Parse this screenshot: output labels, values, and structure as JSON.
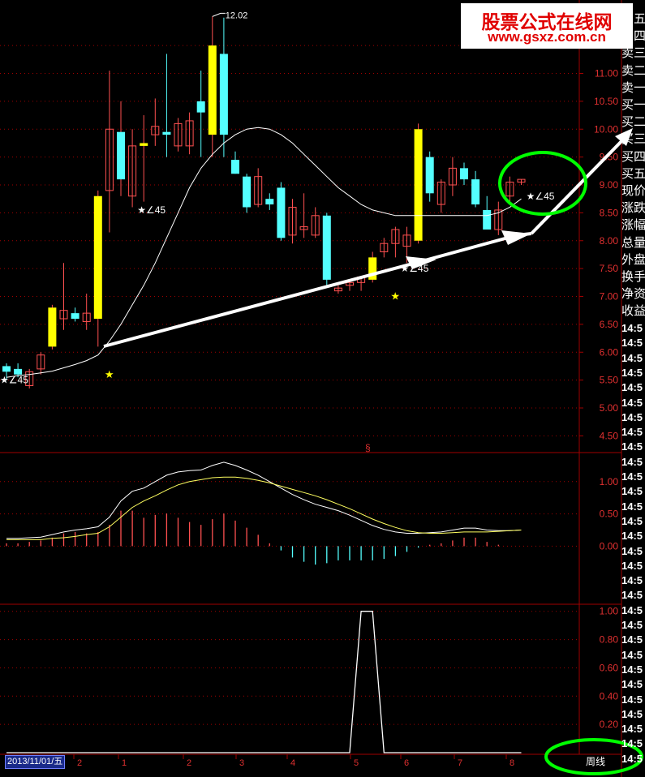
{
  "banner": {
    "title": "股票公式在线网",
    "url": "www.gsxz.com.cn"
  },
  "colors": {
    "up_hollow": "#ff5050",
    "up_yellow": "#ffff00",
    "down": "#54ffff",
    "grid": "#a00000",
    "ma": "#ffffff",
    "arrow": "#ffffff",
    "circle": "#00ff00",
    "axis_text": "#e03030"
  },
  "right_panel": {
    "labels": [
      "卖五",
      "卖四",
      "卖三",
      "卖二",
      "卖一",
      "买一",
      "买二",
      "买三",
      "买四",
      "买五",
      "现价",
      "涨跌",
      "涨幅",
      "总量",
      "外盘",
      "换手",
      "净资",
      "收益"
    ],
    "times": [
      "14:5",
      "14:5",
      "14:5",
      "14:5",
      "14:5",
      "14:5",
      "14:5",
      "14:5",
      "14:5",
      "14:5",
      "14:5",
      "14:5",
      "14:5",
      "14:5",
      "14:5",
      "14:5",
      "14:5",
      "14:5",
      "14:5",
      "14:5",
      "14:5",
      "14:5",
      "14:5",
      "14:5",
      "14:5",
      "14:5",
      "14:5",
      "14:5",
      "14:5",
      "14:5"
    ]
  },
  "period_label": "周线",
  "start_date": "2013/11/01/五",
  "chart_data": [
    {
      "type": "candlestick",
      "ylim": [
        4.2,
        12.2
      ],
      "y_ticks": [
        "4.50",
        "5.00",
        "5.50",
        "6.00",
        "6.50",
        "7.00",
        "7.50",
        "8.00",
        "8.50",
        "9.00",
        "9.50",
        "10.00",
        "10.50",
        "11.00",
        "11.50"
      ],
      "x_tick_labels": [
        "2",
        "1",
        "2",
        "3",
        "4",
        "5",
        "6",
        "7",
        "8"
      ],
      "candles": [
        {
          "o": 5.75,
          "h": 5.8,
          "l": 5.5,
          "c": 5.65
        },
        {
          "o": 5.7,
          "h": 5.8,
          "l": 5.55,
          "c": 5.6
        },
        {
          "o": 5.4,
          "h": 5.7,
          "l": 5.35,
          "c": 5.65
        },
        {
          "o": 5.7,
          "h": 6.0,
          "l": 5.6,
          "c": 5.95
        },
        {
          "o": 6.1,
          "h": 6.85,
          "l": 6.05,
          "c": 6.8
        },
        {
          "o": 6.6,
          "h": 7.6,
          "l": 6.4,
          "c": 6.75
        },
        {
          "o": 6.7,
          "h": 6.8,
          "l": 6.55,
          "c": 6.6
        },
        {
          "o": 6.55,
          "h": 7.05,
          "l": 6.4,
          "c": 6.7
        },
        {
          "o": 6.6,
          "h": 8.9,
          "l": 6.1,
          "c": 8.8
        },
        {
          "o": 8.9,
          "h": 11.05,
          "l": 8.15,
          "c": 10.0
        },
        {
          "o": 9.95,
          "h": 10.5,
          "l": 8.8,
          "c": 9.1
        },
        {
          "o": 8.8,
          "h": 10.0,
          "l": 8.6,
          "c": 9.7
        },
        {
          "o": 9.7,
          "h": 10.25,
          "l": 8.7,
          "c": 9.75
        },
        {
          "o": 9.9,
          "h": 10.55,
          "l": 9.7,
          "c": 10.05
        },
        {
          "o": 9.95,
          "h": 11.35,
          "l": 9.5,
          "c": 9.9
        },
        {
          "o": 9.7,
          "h": 10.2,
          "l": 9.6,
          "c": 10.1
        },
        {
          "o": 9.7,
          "h": 10.3,
          "l": 9.55,
          "c": 10.15
        },
        {
          "o": 10.5,
          "h": 11.05,
          "l": 9.5,
          "c": 10.3
        },
        {
          "o": 9.9,
          "h": 12.02,
          "l": 9.5,
          "c": 11.5
        },
        {
          "o": 11.35,
          "h": 12.0,
          "l": 9.5,
          "c": 9.9
        },
        {
          "o": 9.45,
          "h": 9.6,
          "l": 9.2,
          "c": 9.2
        },
        {
          "o": 9.15,
          "h": 9.2,
          "l": 8.5,
          "c": 8.6
        },
        {
          "o": 8.65,
          "h": 9.3,
          "l": 8.6,
          "c": 9.15
        },
        {
          "o": 8.75,
          "h": 8.85,
          "l": 8.55,
          "c": 8.65
        },
        {
          "o": 8.95,
          "h": 9.05,
          "l": 8.0,
          "c": 8.05
        },
        {
          "o": 8.1,
          "h": 8.75,
          "l": 7.95,
          "c": 8.6
        },
        {
          "o": 8.2,
          "h": 8.85,
          "l": 8.05,
          "c": 8.25
        },
        {
          "o": 8.1,
          "h": 8.6,
          "l": 8.05,
          "c": 8.45
        },
        {
          "o": 8.45,
          "h": 8.5,
          "l": 7.2,
          "c": 7.3
        },
        {
          "o": 7.1,
          "h": 7.2,
          "l": 7.05,
          "c": 7.15
        },
        {
          "o": 7.2,
          "h": 7.3,
          "l": 7.1,
          "c": 7.25
        },
        {
          "o": 7.25,
          "h": 7.35,
          "l": 7.1,
          "c": 7.35
        },
        {
          "o": 7.3,
          "h": 7.8,
          "l": 7.25,
          "c": 7.7
        },
        {
          "o": 7.8,
          "h": 8.05,
          "l": 7.7,
          "c": 7.95
        },
        {
          "o": 7.95,
          "h": 8.25,
          "l": 7.7,
          "c": 8.2
        },
        {
          "o": 7.9,
          "h": 8.25,
          "l": 7.6,
          "c": 8.1
        },
        {
          "o": 8.0,
          "h": 10.1,
          "l": 7.95,
          "c": 10.0
        },
        {
          "o": 9.5,
          "h": 9.6,
          "l": 8.7,
          "c": 8.85
        },
        {
          "o": 8.65,
          "h": 9.1,
          "l": 8.5,
          "c": 9.05
        },
        {
          "o": 9.0,
          "h": 9.5,
          "l": 8.8,
          "c": 9.3
        },
        {
          "o": 9.3,
          "h": 9.4,
          "l": 9.0,
          "c": 9.1
        },
        {
          "o": 9.1,
          "h": 9.25,
          "l": 8.6,
          "c": 8.65
        },
        {
          "o": 8.55,
          "h": 8.8,
          "l": 8.2,
          "c": 8.2
        },
        {
          "o": 8.2,
          "h": 8.7,
          "l": 8.1,
          "c": 8.55
        },
        {
          "o": 8.8,
          "h": 9.15,
          "l": 8.65,
          "c": 9.05
        },
        {
          "o": 9.05,
          "h": 9.1,
          "l": 9.0,
          "c": 9.1
        }
      ],
      "yellow_up_indices": [
        4,
        8,
        10,
        12,
        18,
        32,
        36
      ],
      "ma": [
        5.55,
        5.58,
        5.6,
        5.63,
        5.66,
        5.72,
        5.78,
        5.85,
        5.95,
        6.2,
        6.5,
        6.85,
        7.2,
        7.6,
        8.05,
        8.5,
        8.95,
        9.3,
        9.55,
        9.75,
        9.9,
        10.0,
        10.03,
        10.0,
        9.9,
        9.75,
        9.55,
        9.35,
        9.15,
        8.95,
        8.8,
        8.65,
        8.55,
        8.5,
        8.45,
        8.45,
        8.45,
        8.45,
        8.45,
        8.45,
        8.45,
        8.45,
        8.45,
        8.5,
        8.6,
        8.75
      ],
      "annotations": {
        "max_label": "12.02",
        "angle_label": "∠45",
        "section_mark": "§"
      }
    },
    {
      "type": "line",
      "name": "MACD",
      "ylim": [
        -0.9,
        1.45
      ],
      "y_ticks": [
        "0.00",
        "0.50",
        "1.00"
      ],
      "dif": [
        0.12,
        0.12,
        0.13,
        0.14,
        0.18,
        0.22,
        0.25,
        0.27,
        0.3,
        0.45,
        0.7,
        0.85,
        0.9,
        1.0,
        1.1,
        1.15,
        1.17,
        1.18,
        1.25,
        1.3,
        1.25,
        1.18,
        1.1,
        1.0,
        0.9,
        0.8,
        0.72,
        0.65,
        0.6,
        0.55,
        0.48,
        0.4,
        0.32,
        0.26,
        0.22,
        0.2,
        0.2,
        0.21,
        0.22,
        0.25,
        0.28,
        0.28,
        0.25,
        0.24,
        0.24,
        0.25
      ],
      "dea": [
        0.1,
        0.1,
        0.1,
        0.1,
        0.12,
        0.13,
        0.15,
        0.18,
        0.2,
        0.3,
        0.45,
        0.6,
        0.7,
        0.78,
        0.87,
        0.95,
        1.0,
        1.03,
        1.06,
        1.07,
        1.07,
        1.05,
        1.02,
        0.98,
        0.93,
        0.88,
        0.83,
        0.78,
        0.72,
        0.65,
        0.58,
        0.5,
        0.42,
        0.35,
        0.29,
        0.24,
        0.21,
        0.2,
        0.2,
        0.21,
        0.22,
        0.22,
        0.22,
        0.23,
        0.24,
        0.25
      ]
    },
    {
      "type": "line",
      "ylim": [
        0,
        1.05
      ],
      "y_ticks": [
        "0.20",
        "0.40",
        "0.60",
        "0.80",
        "1.00"
      ],
      "values": [
        0,
        0,
        0,
        0,
        0,
        0,
        0,
        0,
        0,
        0,
        0,
        0,
        0,
        0,
        0,
        0,
        0,
        0,
        0,
        0,
        0,
        0,
        0,
        0,
        0,
        0,
        0,
        0,
        0,
        0,
        0,
        0,
        0,
        0,
        0,
        0,
        0,
        0,
        0,
        0,
        0,
        0,
        0,
        0,
        0,
        0
      ],
      "spike": {
        "start_index": 30,
        "end_index": 33,
        "value": 1.0
      }
    }
  ]
}
